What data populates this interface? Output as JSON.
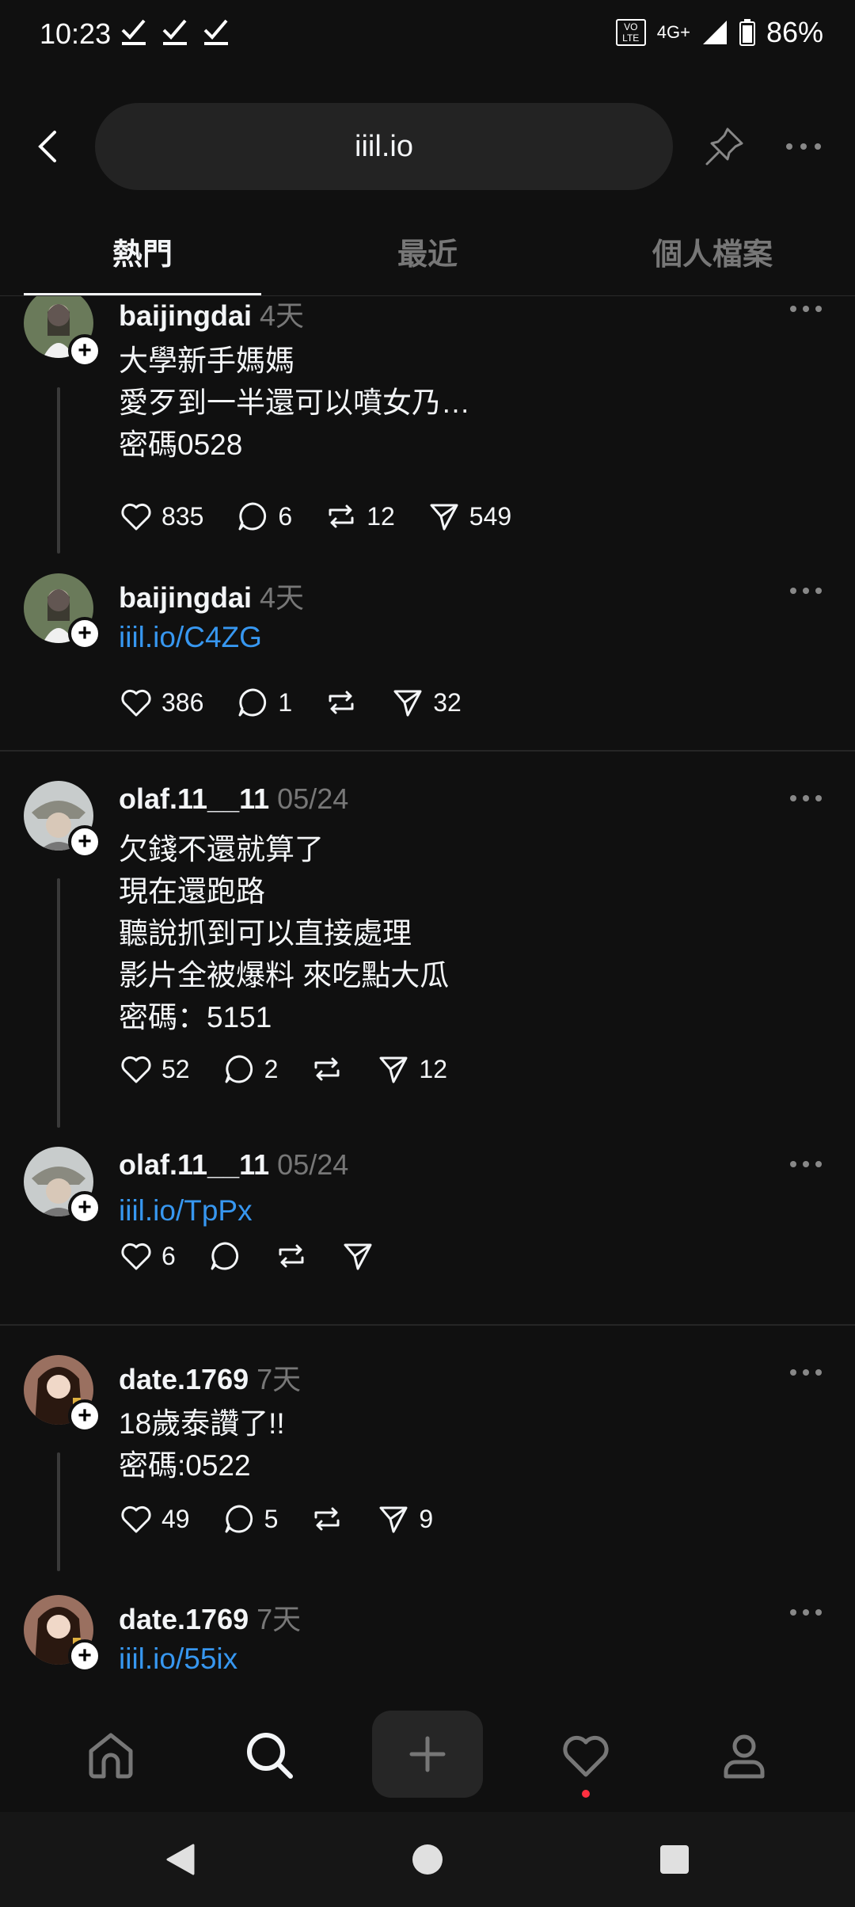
{
  "status_bar": {
    "time": "10:23",
    "network": "4G+",
    "volte": "VO LTE",
    "battery": "86%"
  },
  "top_bar": {
    "url": "iiil.io"
  },
  "tabs": [
    {
      "label": "熱門",
      "active": true
    },
    {
      "label": "最近",
      "active": false
    },
    {
      "label": "個人檔案",
      "active": false
    }
  ],
  "posts": [
    {
      "username": "baijingdai",
      "time": "4天",
      "body": "大學新手媽媽\n愛歹到一半還可以噴女乃…\n密碼0528",
      "likes": "835",
      "comments": "6",
      "reposts": "12",
      "shares": "549"
    },
    {
      "username": "baijingdai",
      "time": "4天",
      "link": "iiil.io/C4ZG",
      "likes": "386",
      "comments": "1",
      "reposts": "",
      "shares": "32"
    },
    {
      "username": "olaf.11__11",
      "time": "05/24",
      "body": "欠錢不還就算了\n現在還跑路\n聽說抓到可以直接處理\n影片全被爆料 來吃點大瓜\n密碼：5151",
      "likes": "52",
      "comments": "2",
      "reposts": "",
      "shares": "12"
    },
    {
      "username": "olaf.11__11",
      "time": "05/24",
      "link": "iiil.io/TpPx",
      "likes": "6",
      "comments": "",
      "reposts": "",
      "shares": ""
    },
    {
      "username": "date.1769",
      "time": "7天",
      "body": "18歲泰讚了!!\n密碼:0522",
      "likes": "49",
      "comments": "5",
      "reposts": "",
      "shares": "9"
    },
    {
      "username": "date.1769",
      "time": "7天",
      "link": "iiil.io/55ix"
    }
  ],
  "bottom_nav": [
    "home-icon",
    "search-icon",
    "new-post-icon",
    "activity-heart-icon",
    "profile-icon"
  ],
  "colors": {
    "background": "#101010",
    "link": "#3797f0",
    "muted": "#777777",
    "notification": "#ff3040"
  }
}
